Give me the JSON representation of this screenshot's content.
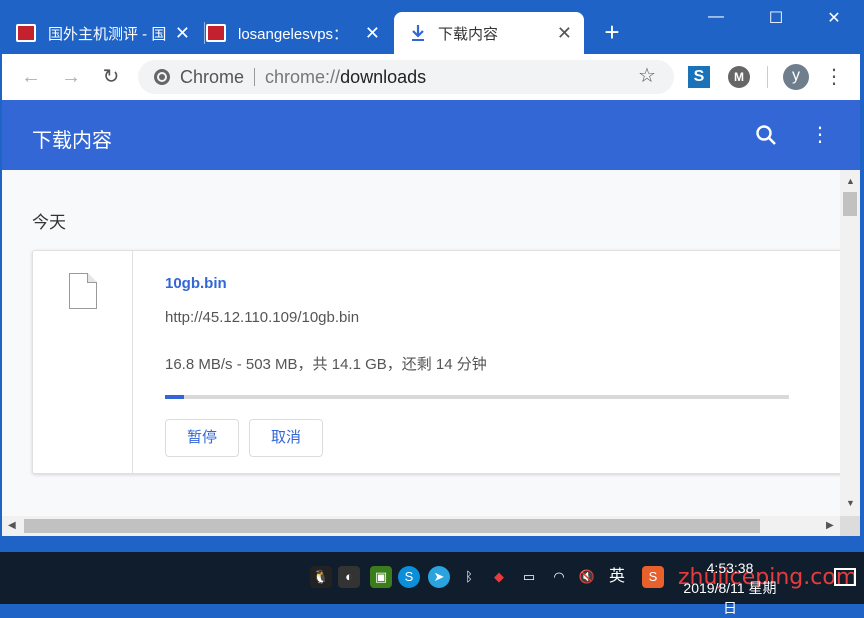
{
  "browser": {
    "tabs": [
      {
        "title": "国外主机测评 - 国",
        "active": false
      },
      {
        "title": "losangelesvps：",
        "active": false
      },
      {
        "title": "下载内容",
        "active": true
      }
    ],
    "window_controls": {
      "minimize": "—",
      "maximize": "☐",
      "close": "✕"
    },
    "omnibox": {
      "chip": "Chrome",
      "scheme": "chrome://",
      "path": "downloads"
    },
    "profile_initial": "y",
    "extensions": [
      {
        "icon": "s-extension-icon",
        "label": "S"
      },
      {
        "icon": "m-extension-icon",
        "label": "M"
      }
    ]
  },
  "downloads_page": {
    "title": "下载内容",
    "section_label": "今天",
    "items": [
      {
        "file_name": "10gb.bin",
        "url": "http://45.12.110.109/10gb.bin",
        "status": "16.8 MB/s - 503 MB，共 14.1 GB，还剩 14 分钟",
        "progress_fraction": 0.03,
        "pause_label": "暂停",
        "cancel_label": "取消"
      }
    ]
  },
  "taskbar": {
    "input_method": "英",
    "time": "4:53:38",
    "date": "2019/8/11 星期日",
    "watermark": "zhujiceping.com"
  },
  "colors": {
    "titlebar": "#1f63c6",
    "header": "#3367d6",
    "accent": "#3367d6",
    "taskbar": "#101d2c"
  }
}
